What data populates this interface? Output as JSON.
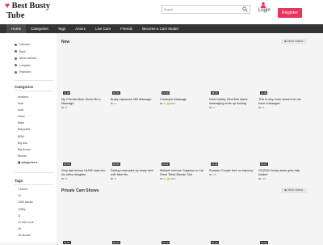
{
  "header": {
    "logo_line1": "Best Busty",
    "logo_line2": "Tube",
    "search_placeholder": "Search...",
    "login_label": "Login",
    "register_label": "Register"
  },
  "nav": {
    "items": [
      "Home",
      "Categories",
      "Tags",
      "Actors",
      "Live Cam",
      "Friends",
      "Become a Cam Model"
    ]
  },
  "sidebar": {
    "sort_items": [
      "Newest",
      "Best",
      "Most viewed",
      "Longest",
      "Random"
    ],
    "categories_heading": "Categories",
    "categories": [
      "Amateur",
      "Anal",
      "Arab",
      "Asian",
      "Babe",
      "Babysitter",
      "BBW",
      "Big Ass",
      "Big Boobs",
      "Blonde",
      "categories"
    ],
    "tags_heading": "Tags",
    "tags": [
      "1 scene",
      "10",
      "1080 facials",
      "1080p",
      "11",
      "12 inch cock",
      "18",
      "18 abused"
    ]
  },
  "sections": {
    "new_title": "New",
    "more_videos_label": "More videos",
    "private_title": "Private Cam Shows"
  },
  "videos": [
    {
      "title": "My Friends Mom Gives Me a Massage",
      "duration": "11:20",
      "views": "95",
      "rating": ""
    },
    {
      "title": "Busty Japanese Milf Massage",
      "duration": "10:26",
      "views": "67",
      "rating": ""
    },
    {
      "title": "Creampie Massage",
      "duration": "12:33",
      "views": "27",
      "rating": "100%"
    },
    {
      "title": "Nina Hartley Nina Elle starts massaging ends up fucking",
      "duration": "08:25",
      "views": "32",
      "rating": ""
    },
    {
      "title": "This is why mom doesn't let me have massages",
      "duration": "11:36",
      "views": "36",
      "rating": ""
    },
    {
      "title": "Step dad shows HUGE load into his wifes daughter",
      "duration": "10:32",
      "views": "60",
      "rating": ""
    },
    {
      "title": "Dating creampies by busty teen with fake tits",
      "duration": "10:05",
      "views": "90",
      "rating": ""
    },
    {
      "title": "Multiple Intense Orgasms in Car Giant Titted Blonde Slut",
      "duration": "10:41",
      "views": "31",
      "rating": "100%"
    },
    {
      "title": "Russian Couple fuck on balcony",
      "duration": "11:46",
      "views": "118",
      "rating": ""
    },
    {
      "title": "OOZING busty asian gets fully loaded",
      "duration": "16:07",
      "views": "108",
      "rating": ""
    }
  ],
  "private_videos": [
    {
      "duration": "01:00"
    },
    {
      "duration": "01:00"
    },
    {
      "duration": "01:00"
    },
    {
      "duration": "01:00"
    },
    {
      "duration": "01:00"
    }
  ],
  "colors": {
    "brand": "#e8345a",
    "nav_bg": "#343434",
    "rating_green": "#1a9b3a"
  }
}
